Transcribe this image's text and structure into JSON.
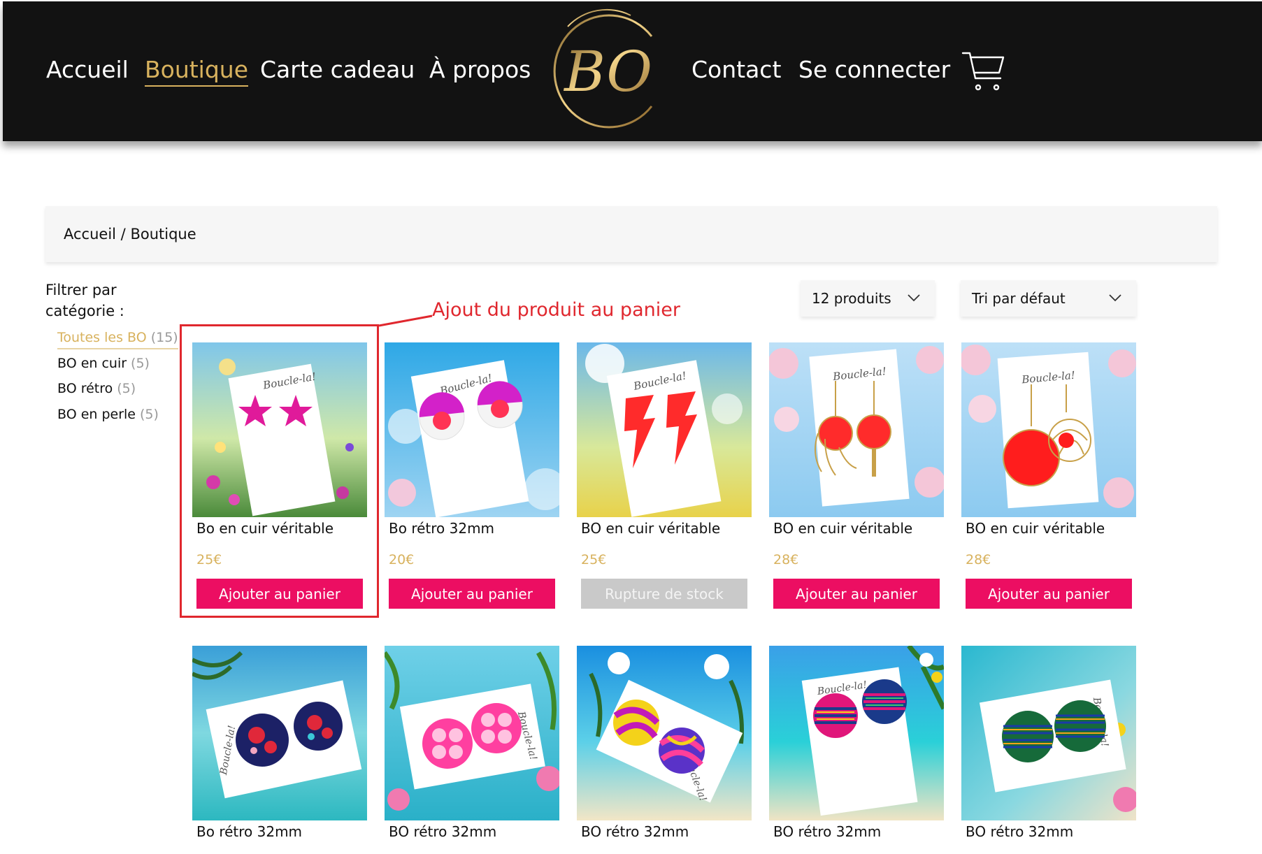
{
  "header": {
    "nav_left": [
      "Accueil",
      "Boutique",
      "Carte cadeau",
      "À propos"
    ],
    "nav_right": [
      "Contact",
      "Se connecter"
    ],
    "logo_text": "BO",
    "active_nav": "Boutique",
    "colors": {
      "background": "#121212",
      "gold": "#d8b25e",
      "text": "#ffffff"
    },
    "cart_icon": "shopping-cart-icon"
  },
  "breadcrumb": {
    "home": "Accueil",
    "separator": " / ",
    "current": "Boutique"
  },
  "sidebar": {
    "title": "Filtrer par catégorie :",
    "categories": [
      {
        "label": "Toutes les BO",
        "count": "(15)",
        "active": true
      },
      {
        "label": "BO en cuir",
        "count": "(5)"
      },
      {
        "label": "BO rétro",
        "count": "(5)"
      },
      {
        "label": "BO en perle",
        "count": "(5)"
      }
    ]
  },
  "toolbar": {
    "per_page": "12 produits",
    "sort": "Tri par défaut",
    "chevron_icon": "chevron-down-icon"
  },
  "annotation": {
    "text": "Ajout du produit au panier",
    "color": "#e0272e"
  },
  "card_text": "Boucle-la!",
  "products": [
    {
      "name": "Bo en cuir véritable",
      "price": "25€",
      "button": "Ajouter au panier"
    },
    {
      "name": "Bo rétro 32mm",
      "price": "20€",
      "button": "Ajouter au panier"
    },
    {
      "name": "BO en cuir véritable",
      "price": "25€",
      "button": "Rupture de stock",
      "out_of_stock": true
    },
    {
      "name": "BO en cuir véritable",
      "price": "28€",
      "button": "Ajouter au panier"
    },
    {
      "name": "BO en cuir véritable",
      "price": "28€",
      "button": "Ajouter au panier"
    },
    {
      "name": "Bo rétro 32mm"
    },
    {
      "name": "BO rétro 32mm"
    },
    {
      "name": "BO rétro 32mm"
    },
    {
      "name": "BO rétro 32mm"
    },
    {
      "name": "BO rétro 32mm"
    }
  ],
  "colors": {
    "price": "#d8b25e",
    "button": "#ec0e62",
    "button_disabled": "#c9c9c9"
  }
}
